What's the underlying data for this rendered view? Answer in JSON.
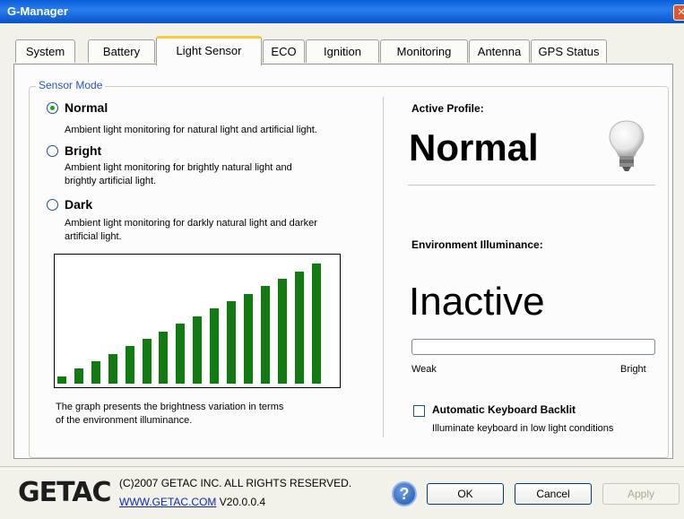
{
  "window": {
    "title": "G-Manager"
  },
  "tabs": [
    {
      "label": "System"
    },
    {
      "label": "Battery"
    },
    {
      "label": "Light Sensor",
      "active": true
    },
    {
      "label": "ECO"
    },
    {
      "label": "Ignition"
    },
    {
      "label": "Monitoring"
    },
    {
      "label": "Antenna"
    },
    {
      "label": "GPS Status"
    }
  ],
  "sensor_mode": {
    "group_label": "Sensor Mode",
    "selected": "Normal",
    "options": [
      {
        "label": "Normal",
        "desc_lines": [
          "Ambient light monitoring for natural light and artificial light."
        ]
      },
      {
        "label": "Bright",
        "desc_lines": [
          "Ambient light monitoring for brightly natural light and",
          "brightly artificial light."
        ]
      },
      {
        "label": "Dark",
        "desc_lines": [
          "Ambient light monitoring for darkly natural light and darker",
          "artificial light."
        ]
      }
    ]
  },
  "graph": {
    "caption_lines": [
      "The graph presents the brightness variation in terms",
      "of the environment illuminance."
    ],
    "color": "#117b11"
  },
  "chart_data": {
    "type": "bar",
    "values": [
      1,
      2,
      3,
      4,
      5,
      6,
      7,
      8,
      9,
      10,
      11,
      12,
      13,
      14,
      15,
      16
    ],
    "ylim": [
      0,
      17
    ]
  },
  "active_profile": {
    "label": "Active Profile:",
    "value": "Normal",
    "icon": "light-bulb-icon"
  },
  "environment": {
    "label": "Environment Illuminance:",
    "value": "Inactive",
    "level": 0,
    "weak_label": "Weak",
    "bright_label": "Bright"
  },
  "backlight": {
    "label": "Automatic Keyboard Backlit",
    "desc": "Illuminate keyboard in low light conditions",
    "checked": false
  },
  "footer": {
    "logo": "GETAC",
    "copyright": "(C)2007 GETAC INC. ALL RIGHTS RESERVED.",
    "link": "WWW.GETAC.COM",
    "version": "V20.0.0.4",
    "ok_label": "OK",
    "cancel_label": "Cancel",
    "apply_label": "Apply"
  }
}
